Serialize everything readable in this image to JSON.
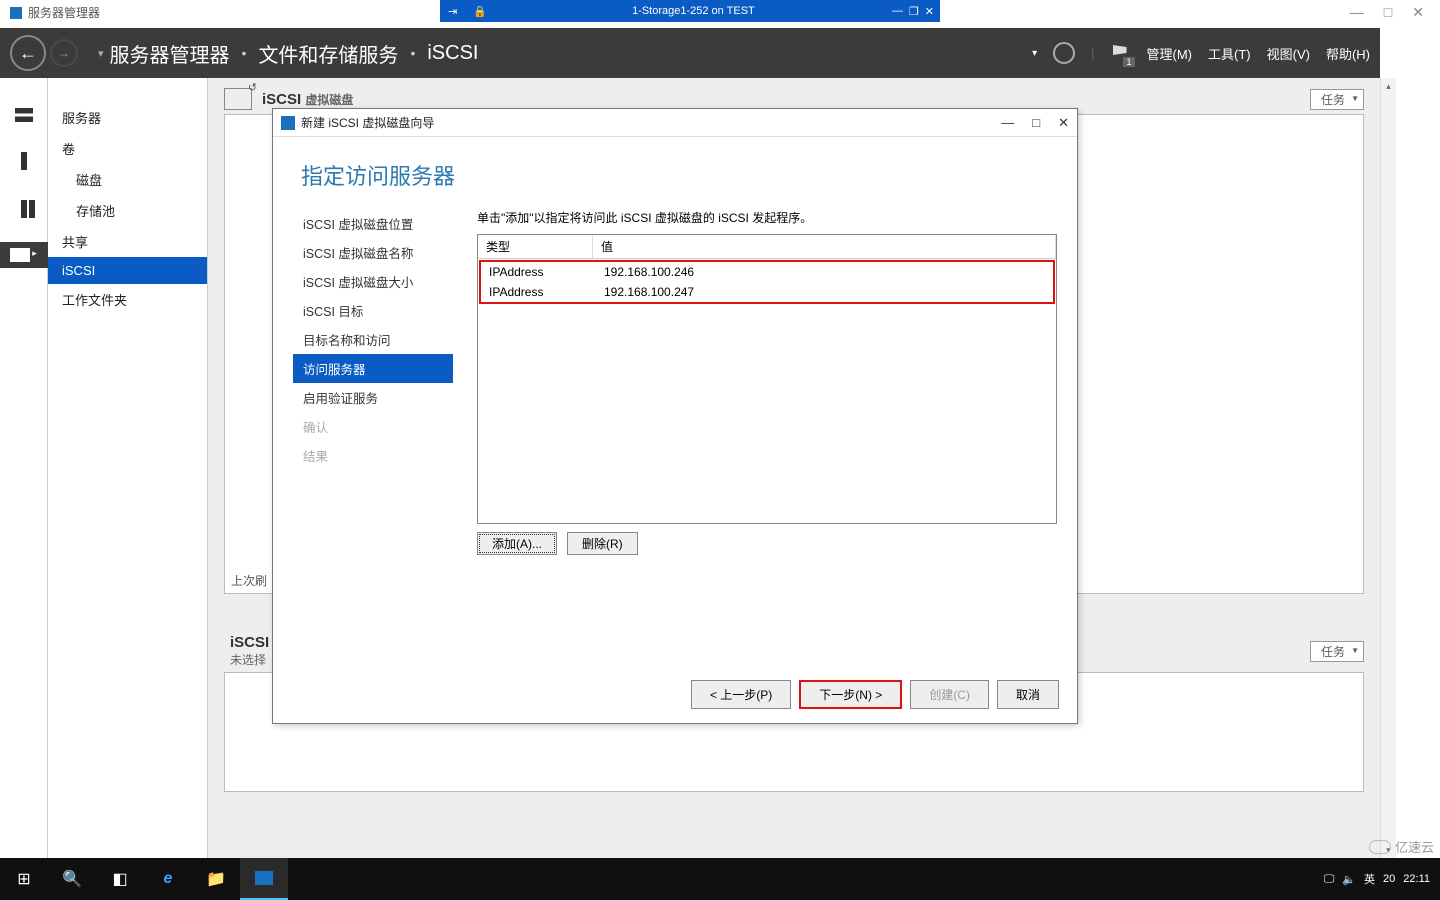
{
  "outer_window": {
    "min": "—",
    "max": "□",
    "close": "✕"
  },
  "vm_titlebar": {
    "title": "1-Storage1-252 on TEST",
    "pin": "⇥",
    "lock": "🔒",
    "min": "—",
    "max": "❐",
    "close": "✕"
  },
  "app_small": {
    "title": "服务器管理器"
  },
  "header": {
    "breadcrumb": [
      "服务器管理器",
      "文件和存储服务",
      "iSCSI"
    ],
    "dropdown": "▾",
    "menu": {
      "manage": "管理(M)",
      "tools": "工具(T)",
      "view": "视图(V)",
      "help": "帮助(H)"
    },
    "flag_badge": "1"
  },
  "sidebar": {
    "items": [
      {
        "label": "服务器",
        "sub": false,
        "selected": false
      },
      {
        "label": "卷",
        "sub": false,
        "selected": false
      },
      {
        "label": "磁盘",
        "sub": true,
        "selected": false
      },
      {
        "label": "存储池",
        "sub": true,
        "selected": false
      },
      {
        "label": "共享",
        "sub": false,
        "selected": false
      },
      {
        "label": "iSCSI",
        "sub": false,
        "selected": true
      },
      {
        "label": "工作文件夹",
        "sub": false,
        "selected": false
      }
    ]
  },
  "panels": {
    "p1": {
      "title": "iSCSI",
      "subtitle": "虚拟磁盘",
      "tasks": "任务",
      "footer": "上次刷"
    },
    "p2": {
      "title": "iSCSI",
      "subtitle": "未选择",
      "tasks": "任务"
    }
  },
  "wizard": {
    "window_title": "新建 iSCSI 虚拟磁盘向导",
    "heading": "指定访问服务器",
    "steps": [
      {
        "label": "iSCSI 虚拟磁盘位置",
        "state": "done"
      },
      {
        "label": "iSCSI 虚拟磁盘名称",
        "state": "done"
      },
      {
        "label": "iSCSI 虚拟磁盘大小",
        "state": "done"
      },
      {
        "label": "iSCSI 目标",
        "state": "done"
      },
      {
        "label": "目标名称和访问",
        "state": "done"
      },
      {
        "label": "访问服务器",
        "state": "current"
      },
      {
        "label": "启用验证服务",
        "state": "done"
      },
      {
        "label": "确认",
        "state": "future"
      },
      {
        "label": "结果",
        "state": "future"
      }
    ],
    "instruction": "单击\"添加\"以指定将访问此 iSCSI 虚拟磁盘的 iSCSI 发起程序。",
    "table": {
      "headers": {
        "type": "类型",
        "value": "值"
      },
      "rows": [
        {
          "type": "IPAddress",
          "value": "192.168.100.246"
        },
        {
          "type": "IPAddress",
          "value": "192.168.100.247"
        }
      ]
    },
    "buttons": {
      "add": "添加(A)...",
      "remove": "删除(R)"
    },
    "footer": {
      "prev": "< 上一步(P)",
      "next": "下一步(N) >",
      "create": "创建(C)",
      "cancel": "取消"
    },
    "win_controls": {
      "min": "—",
      "max": "□",
      "close": "✕"
    }
  },
  "taskbar": {
    "tray": {
      "ime": "英",
      "notif": "20",
      "time": "22:11"
    }
  },
  "watermark": "亿速云"
}
